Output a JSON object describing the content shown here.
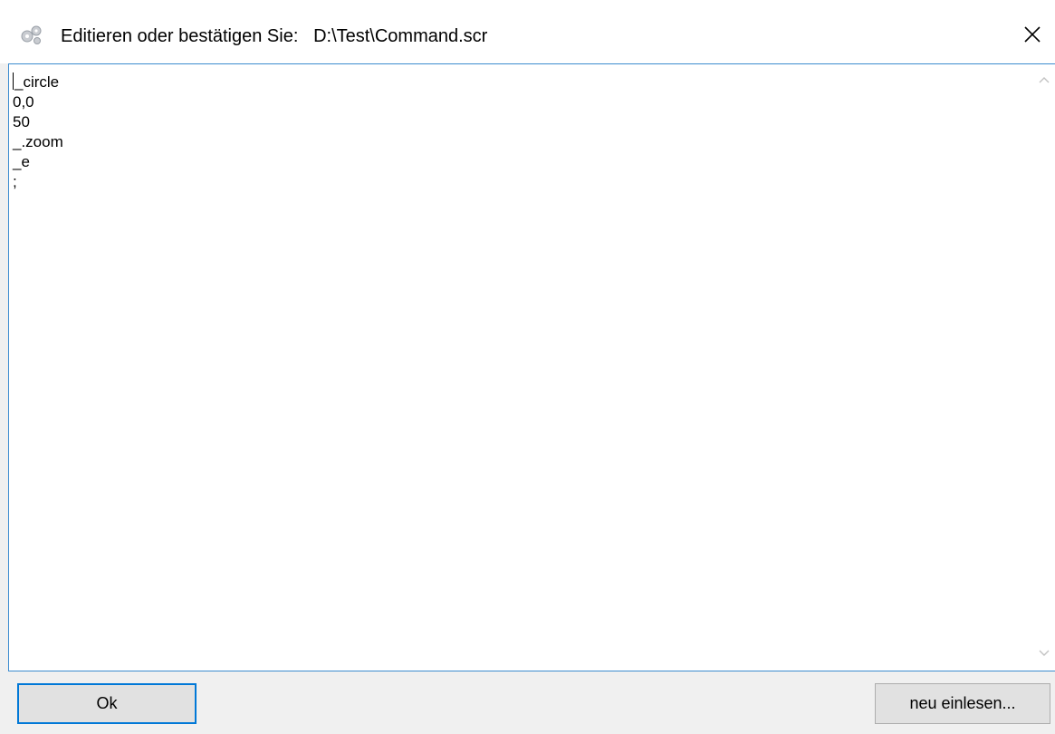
{
  "window": {
    "title": "Editieren oder bestätigen Sie:   D:\\Test\\Command.scr",
    "close_icon": "close-icon"
  },
  "editor": {
    "content": "_circle\n0,0\n50\n_.zoom\n_e\n;"
  },
  "buttons": {
    "ok_label": "Ok",
    "reload_label": "neu einlesen..."
  },
  "colors": {
    "accent": "#0078d7",
    "editor_border": "#3c8ccf",
    "button_bg": "#e1e1e1"
  }
}
